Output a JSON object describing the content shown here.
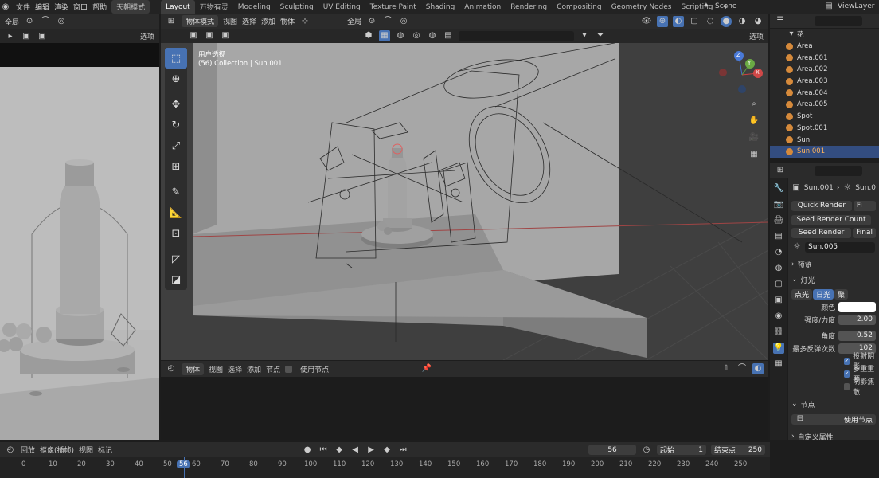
{
  "topbar": {
    "menus": [
      "文件",
      "编辑",
      "渲染",
      "窗口",
      "帮助"
    ],
    "mode": "天朝模式",
    "tabs": [
      "Layout",
      "万物有灵",
      "Modeling",
      "Sculpting",
      "UV Editing",
      "Texture Paint",
      "Shading",
      "Animation",
      "Rendering",
      "Compositing",
      "Geometry Nodes",
      "Scripting"
    ],
    "active_tab": "Layout",
    "scene": "Scene",
    "viewlayer": "ViewLayer"
  },
  "left_view": {
    "global": "全局",
    "options": "选项"
  },
  "viewport": {
    "mode": "物体模式",
    "menus": [
      "视图",
      "选择",
      "添加",
      "物体"
    ],
    "global": "全局",
    "options": "选项",
    "overlay_title": "用户透视",
    "overlay_sub": "(56) Collection | Sun.001",
    "axis": {
      "x": "X",
      "y": "Y",
      "z": "Z"
    }
  },
  "node_editor": {
    "type": "物体",
    "menus": [
      "视图",
      "选择",
      "添加",
      "节点"
    ],
    "use_nodes": "使用节点"
  },
  "outliner": {
    "items": [
      {
        "name": "花",
        "type": "obj"
      },
      {
        "name": "Area",
        "type": "light"
      },
      {
        "name": "Area.001",
        "type": "light"
      },
      {
        "name": "Area.002",
        "type": "light"
      },
      {
        "name": "Area.003",
        "type": "light"
      },
      {
        "name": "Area.004",
        "type": "light"
      },
      {
        "name": "Area.005",
        "type": "light"
      },
      {
        "name": "Spot",
        "type": "light"
      },
      {
        "name": "Spot.001",
        "type": "light"
      },
      {
        "name": "Sun",
        "type": "light"
      },
      {
        "name": "Sun.001",
        "type": "light"
      }
    ],
    "selected": "Sun.001"
  },
  "properties": {
    "object": "Sun.001",
    "data": "Sun.0",
    "quick_render": "Quick Render",
    "fi": "Fi",
    "seed_count": "Seed Render Count",
    "seed_render": "Seed Render",
    "final": "Final",
    "light_data": "Sun.005",
    "preview": "预览",
    "light": "灯光",
    "types": [
      "点光",
      "日光",
      "聚"
    ],
    "color_label": "颜色",
    "strength_label": "强度/力度",
    "strength": "2.00",
    "angle_label": "角度",
    "angle": "0.52",
    "bounces_label": "最多反弹次数",
    "bounces": "102",
    "cast_shadow": "投射阴影",
    "multi_importance": "多重重要",
    "shadow_caustics": "阴影焦散",
    "nodes": "节点",
    "use_nodes": "使用节点",
    "custom_props": "自定义属性"
  },
  "timeline": {
    "playback": "回放",
    "keying": "抠像(插帧)",
    "view": "视图",
    "marker": "标记",
    "current": "56",
    "start_label": "起始",
    "start": "1",
    "end_label": "结束点",
    "end": "250",
    "ticks": [
      "0",
      "10",
      "20",
      "30",
      "40",
      "50",
      "56",
      "60",
      "70",
      "80",
      "90",
      "100",
      "110",
      "120",
      "130",
      "140",
      "150",
      "160",
      "170",
      "180",
      "190",
      "200",
      "210",
      "220",
      "230",
      "240",
      "250"
    ]
  }
}
